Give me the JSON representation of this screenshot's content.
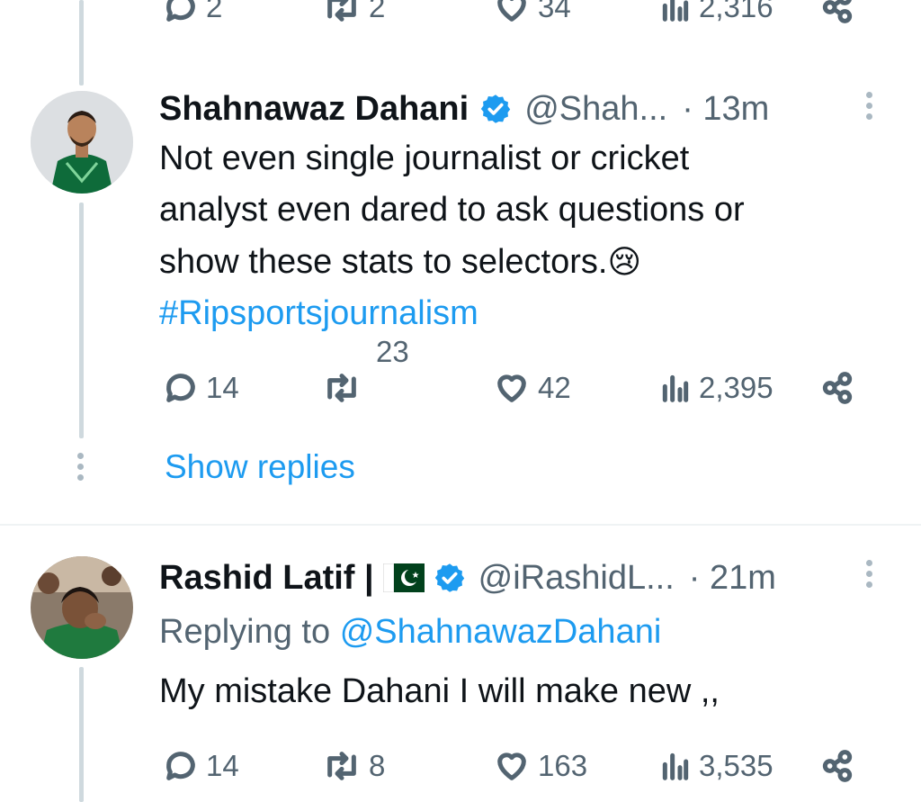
{
  "top_tweet": {
    "metrics": {
      "replies": "2",
      "retweets": "2",
      "likes": "34",
      "views": "2,316"
    }
  },
  "tweet1": {
    "name": "Shahnawaz Dahani",
    "handle": "@Shah...",
    "time": "· 13m",
    "body_lines": [
      "Not even single journalist or cricket",
      "analyst even dared to ask questions or",
      "show these stats to selectors."
    ],
    "emoji": "😢",
    "hashtag": "#Ripsportsjournalism",
    "metrics": {
      "replies": "14",
      "retweets": "23",
      "likes": "42",
      "views": "2,395"
    }
  },
  "show_replies": "Show replies",
  "tweet2": {
    "name": "Rashid Latif |",
    "handle": "@iRashidL...",
    "time": "· 21m",
    "replying_prefix": "Replying to",
    "replying_handle": "@ShahnawazDahani",
    "body": "My mistake Dahani I will make new ,,",
    "metrics": {
      "replies": "14",
      "retweets": "8",
      "likes": "163",
      "views": "3,535"
    }
  },
  "icons": {
    "reply": "reply-icon",
    "retweet": "retweet-icon",
    "like": "heart-icon",
    "views": "views-icon",
    "share": "share-icon",
    "verified": "verified-badge-icon",
    "more": "more-vertical-icon",
    "flag": "pakistan-flag-icon"
  },
  "colors": {
    "link": "#1d9bf0",
    "secondary_text": "#536471",
    "primary_text": "#0f1419",
    "thread_line": "#cfd9de",
    "pakistan_green": "#01411c"
  }
}
